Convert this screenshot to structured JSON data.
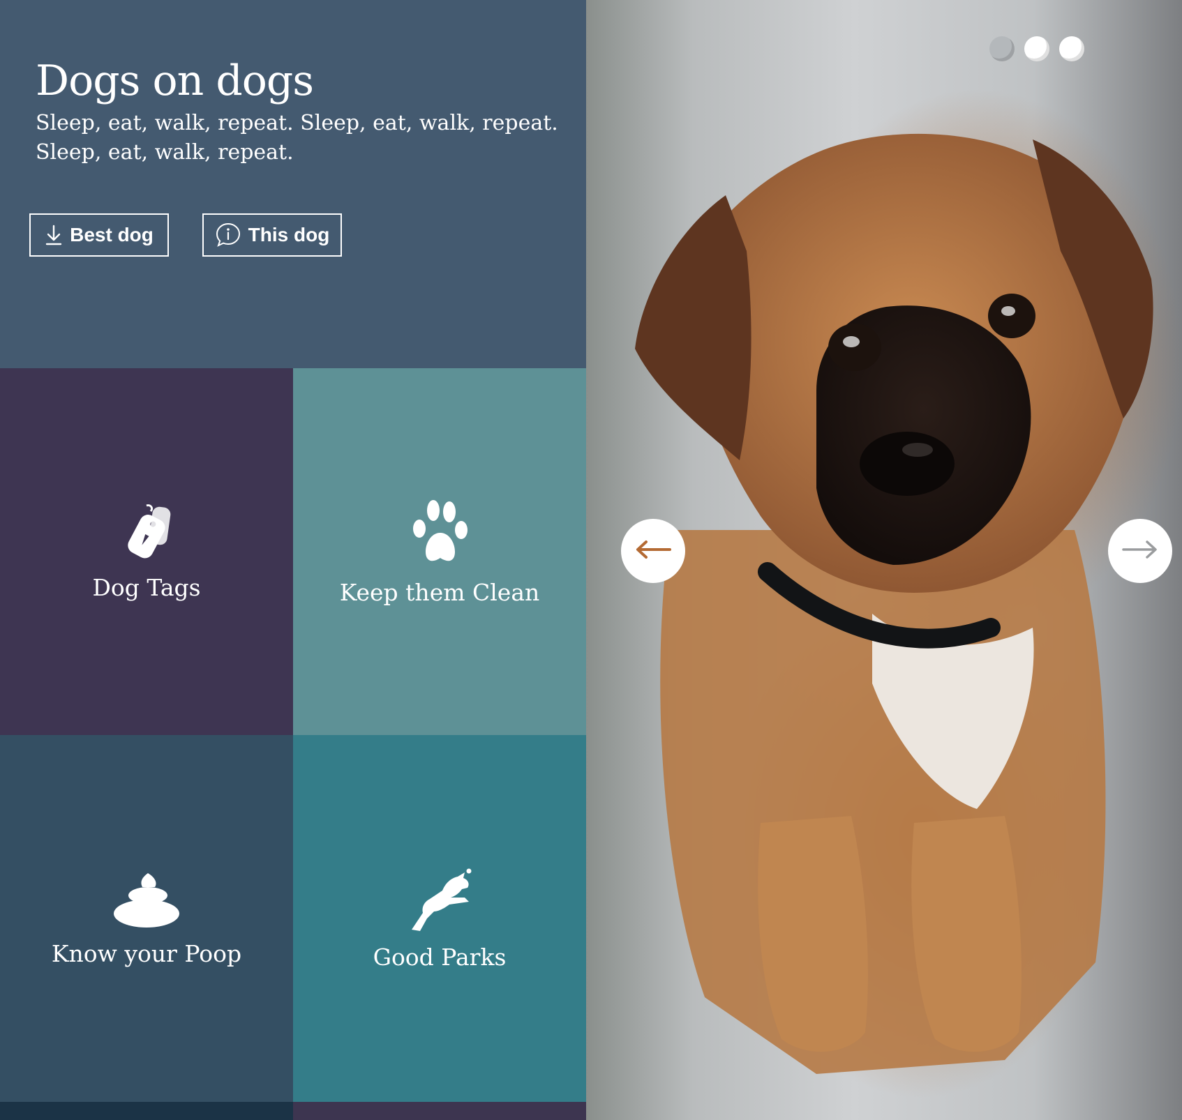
{
  "hero": {
    "title": "Dogs on dogs",
    "subtitle": "Sleep, eat, walk, repeat. Sleep, eat, walk, repeat. Sleep, eat, walk, repeat.",
    "buttons": [
      {
        "label": "Best dog",
        "icon": "download-icon"
      },
      {
        "label": "This dog",
        "icon": "info-bubble-icon"
      }
    ],
    "background": "#445a70"
  },
  "tiles": [
    {
      "label": "Dog Tags",
      "icon": "dog-tag-icon",
      "color": "#3e3552"
    },
    {
      "label": "Keep them Clean",
      "icon": "paw-icon",
      "color": "#5e9196"
    },
    {
      "label": "Know your Poop",
      "icon": "poop-icon",
      "color": "#344f63"
    },
    {
      "label": "Good Parks",
      "icon": "jumping-dog-icon",
      "color": "#347d89"
    }
  ],
  "gallery": {
    "image": "puppy-photo",
    "slide_dots": 3,
    "active_slide_index": 0,
    "prev_icon": "arrow-left-icon",
    "next_icon": "arrow-right-icon"
  }
}
